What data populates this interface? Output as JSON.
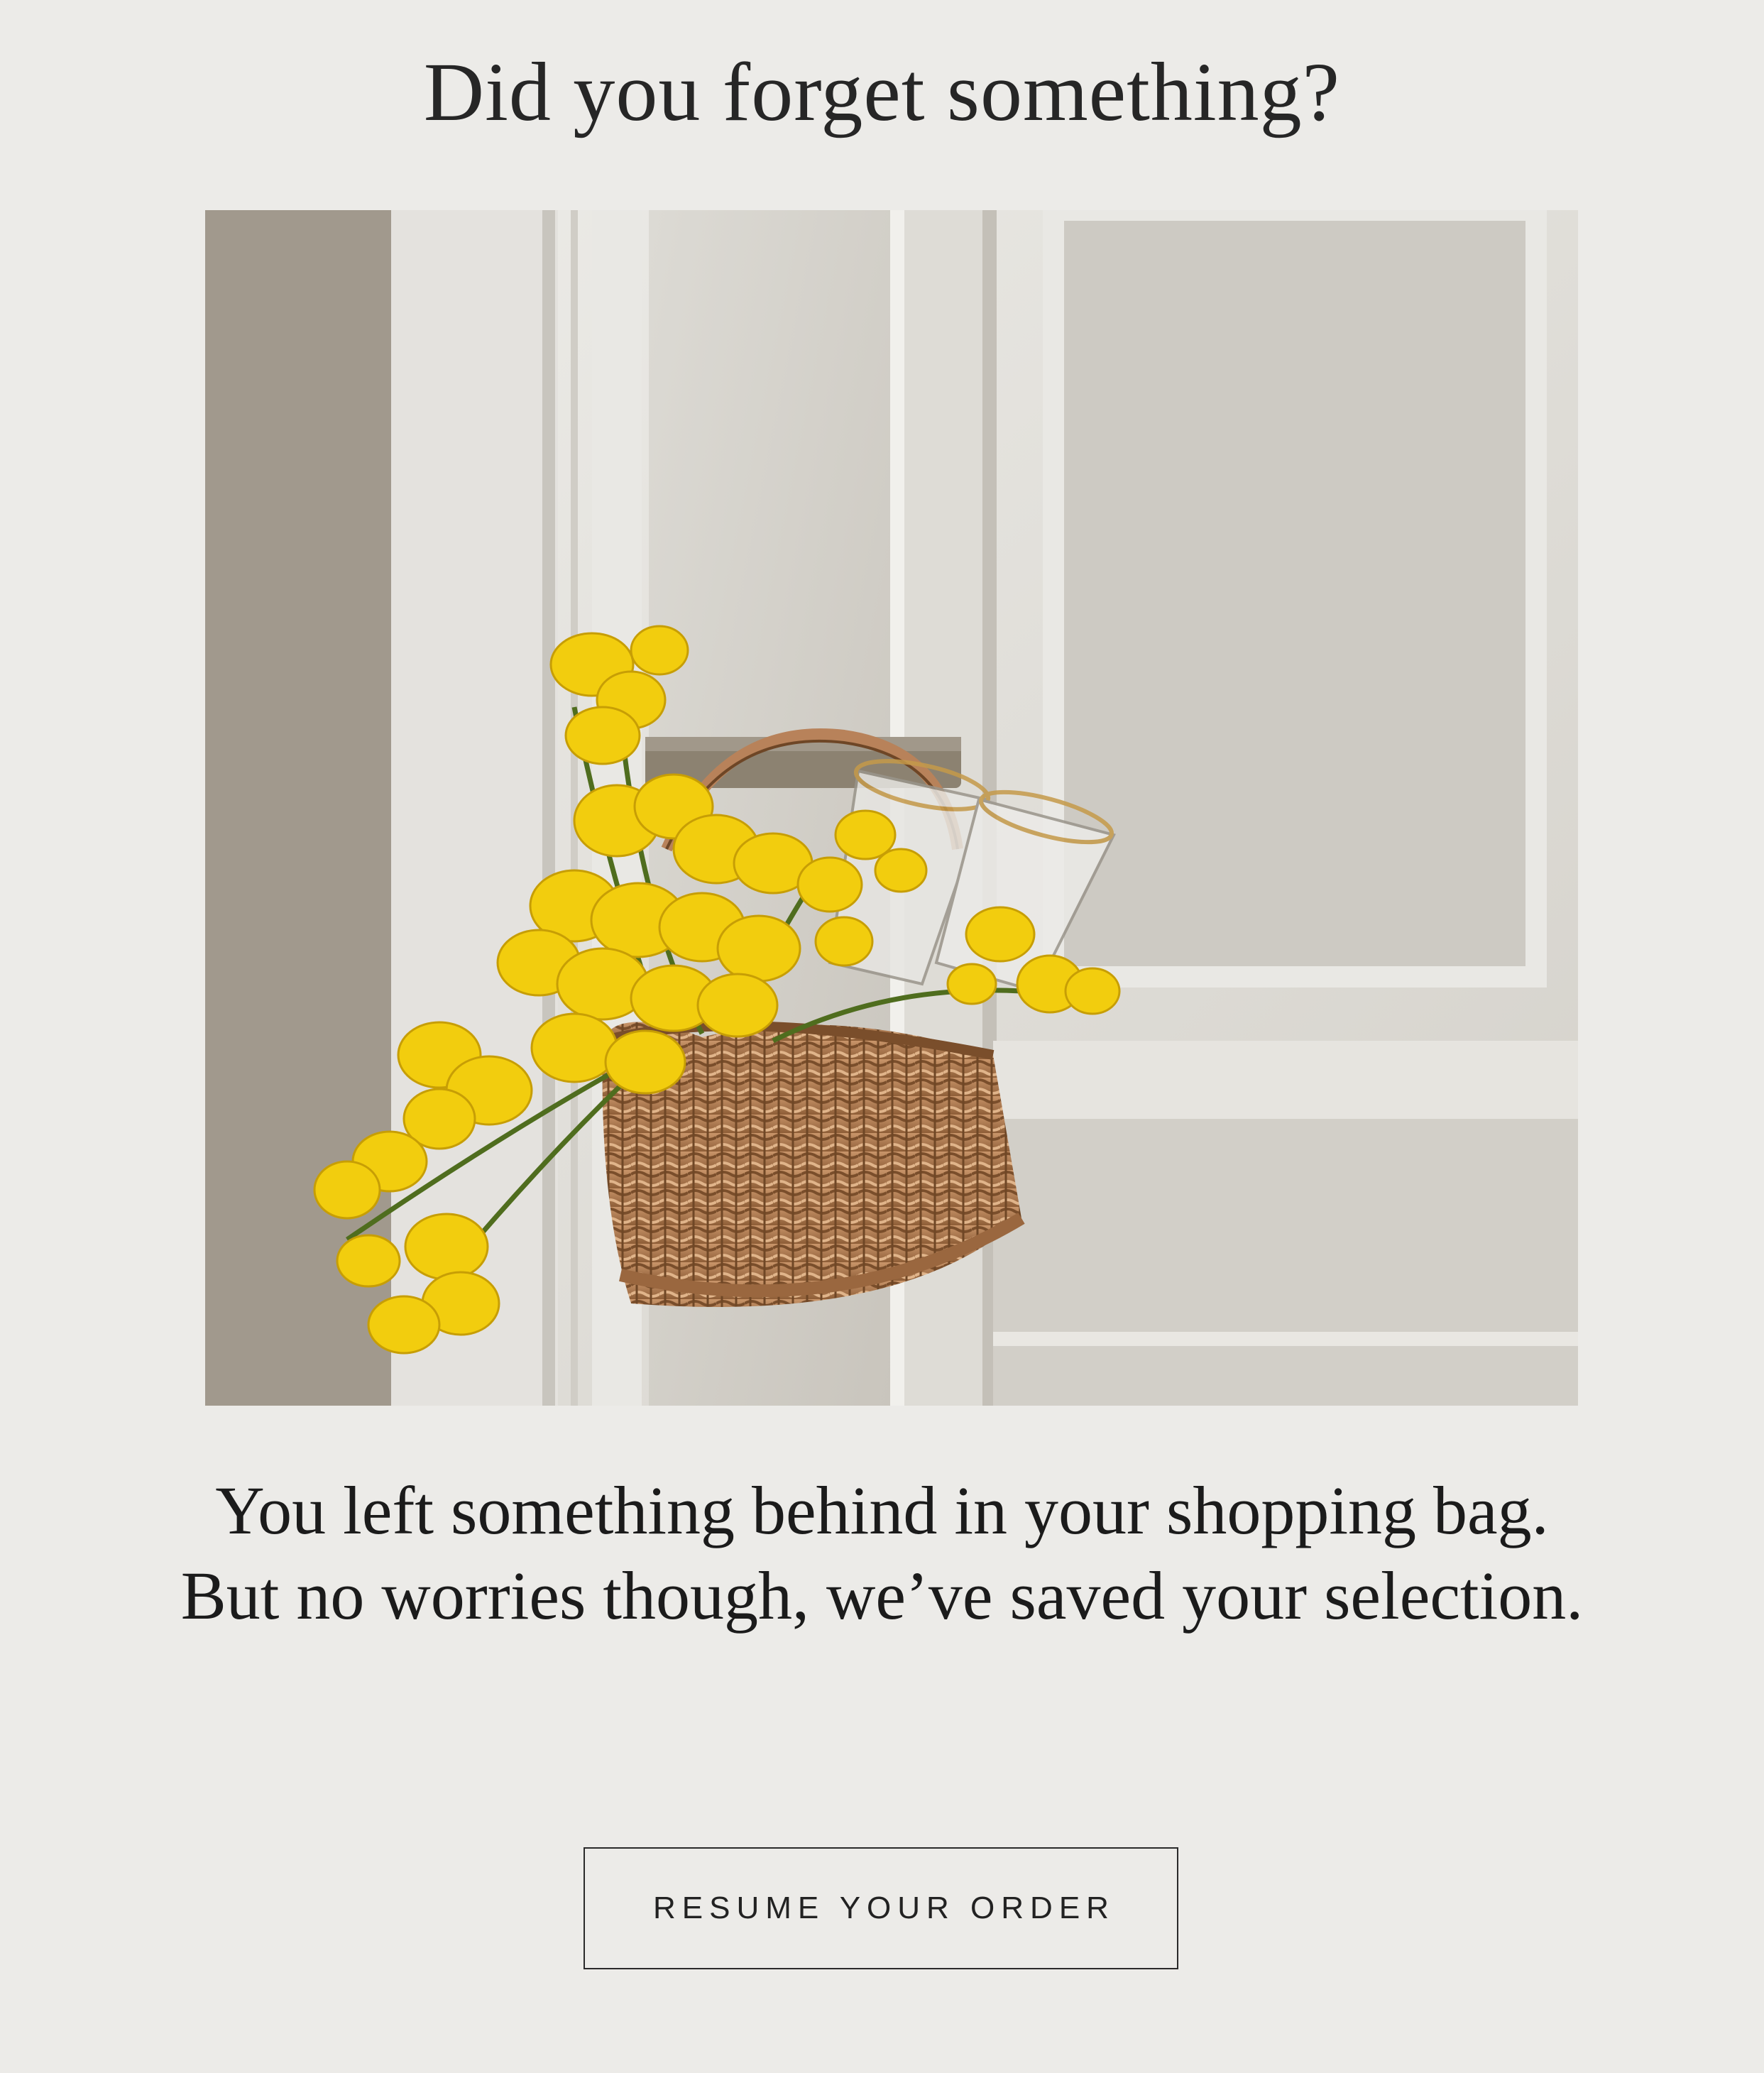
{
  "email": {
    "headline": "Did you forget something?",
    "hero_image": {
      "description_icon": "flower-basket-on-door-handle-photo",
      "colors": {
        "door": "#e6e4df",
        "wall": "#a39c90",
        "flowers": "#f3cf0e",
        "basket": "#b47c4c",
        "background": "#ecebe8"
      }
    },
    "message": "You left something behind in your shopping bag. But no worries though, we’ve saved your selection.",
    "cta_label": "RESUME YOUR ORDER"
  }
}
